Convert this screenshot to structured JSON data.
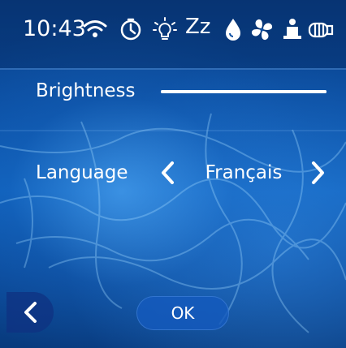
{
  "status_bar": {
    "time": "10:43",
    "icons": [
      "wifi-icon",
      "timer-icon",
      "light-icon",
      "sleep-icon",
      "water-drop-icon",
      "fan-icon",
      "jet-icon",
      "filter-icon"
    ],
    "sleep_label": "Zz"
  },
  "settings": {
    "brightness": {
      "label": "Brightness",
      "level": 1.0
    },
    "language": {
      "label": "Language",
      "value": "Français",
      "prev_arrow": "‹",
      "next_arrow": "›"
    }
  },
  "footer": {
    "ok_label": "OK"
  },
  "colors": {
    "background": "#0b4fa3",
    "text": "#ffffff",
    "slider": "#ffffff"
  }
}
